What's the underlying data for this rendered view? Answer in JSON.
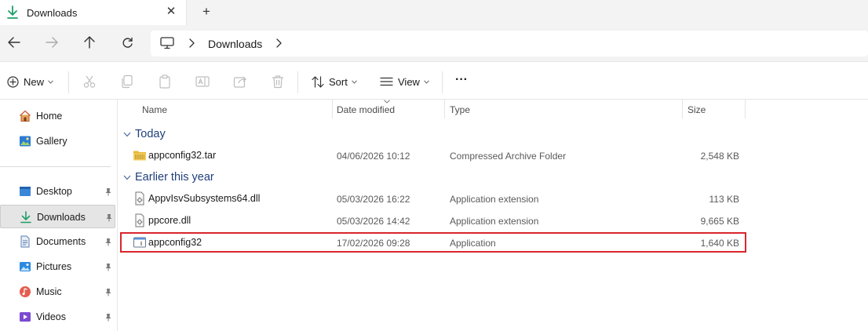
{
  "tab": {
    "title": "Downloads",
    "close_glyph": "✕",
    "new_tab_glyph": "+"
  },
  "address": {
    "crumb": "Downloads"
  },
  "toolbar": {
    "new_label": "New",
    "sort_label": "Sort",
    "view_label": "View",
    "more_glyph": "···"
  },
  "sidebar": {
    "items": [
      {
        "label": "Home",
        "icon": "home-icon",
        "pinned": false,
        "active": false
      },
      {
        "label": "Gallery",
        "icon": "gallery-icon",
        "pinned": false,
        "active": false
      },
      {
        "label": "Desktop",
        "icon": "desktop-icon",
        "pinned": true,
        "active": false
      },
      {
        "label": "Downloads",
        "icon": "download-icon",
        "pinned": true,
        "active": true
      },
      {
        "label": "Documents",
        "icon": "documents-icon",
        "pinned": true,
        "active": false
      },
      {
        "label": "Pictures",
        "icon": "pictures-icon",
        "pinned": true,
        "active": false
      },
      {
        "label": "Music",
        "icon": "music-icon",
        "pinned": true,
        "active": false
      },
      {
        "label": "Videos",
        "icon": "videos-icon",
        "pinned": true,
        "active": false
      }
    ]
  },
  "columns": {
    "name": "Name",
    "date": "Date modified",
    "type": "Type",
    "size": "Size"
  },
  "groups": [
    {
      "label": "Today",
      "files": [
        {
          "name": "appconfig32.tar",
          "date": "04/06/2026 10:12",
          "type": "Compressed Archive Folder",
          "size": "2,548 KB",
          "icon": "zip-folder-icon"
        }
      ]
    },
    {
      "label": "Earlier this year",
      "files": [
        {
          "name": "AppvIsvSubsystems64.dll",
          "date": "05/03/2026 16:22",
          "type": "Application extension",
          "size": "113 KB",
          "icon": "dll-file-icon"
        },
        {
          "name": "ppcore.dll",
          "date": "05/03/2026 14:42",
          "type": "Application extension",
          "size": "9,665 KB",
          "icon": "dll-file-icon"
        },
        {
          "name": "appconfig32",
          "date": "17/02/2026 09:28",
          "type": "Application",
          "size": "1,640 KB",
          "icon": "application-icon"
        }
      ]
    }
  ],
  "colors": {
    "accent": "#1f7a4d",
    "group_text": "#1f3e7a",
    "highlight": "#d9262b",
    "folder": "#e8b83a"
  }
}
